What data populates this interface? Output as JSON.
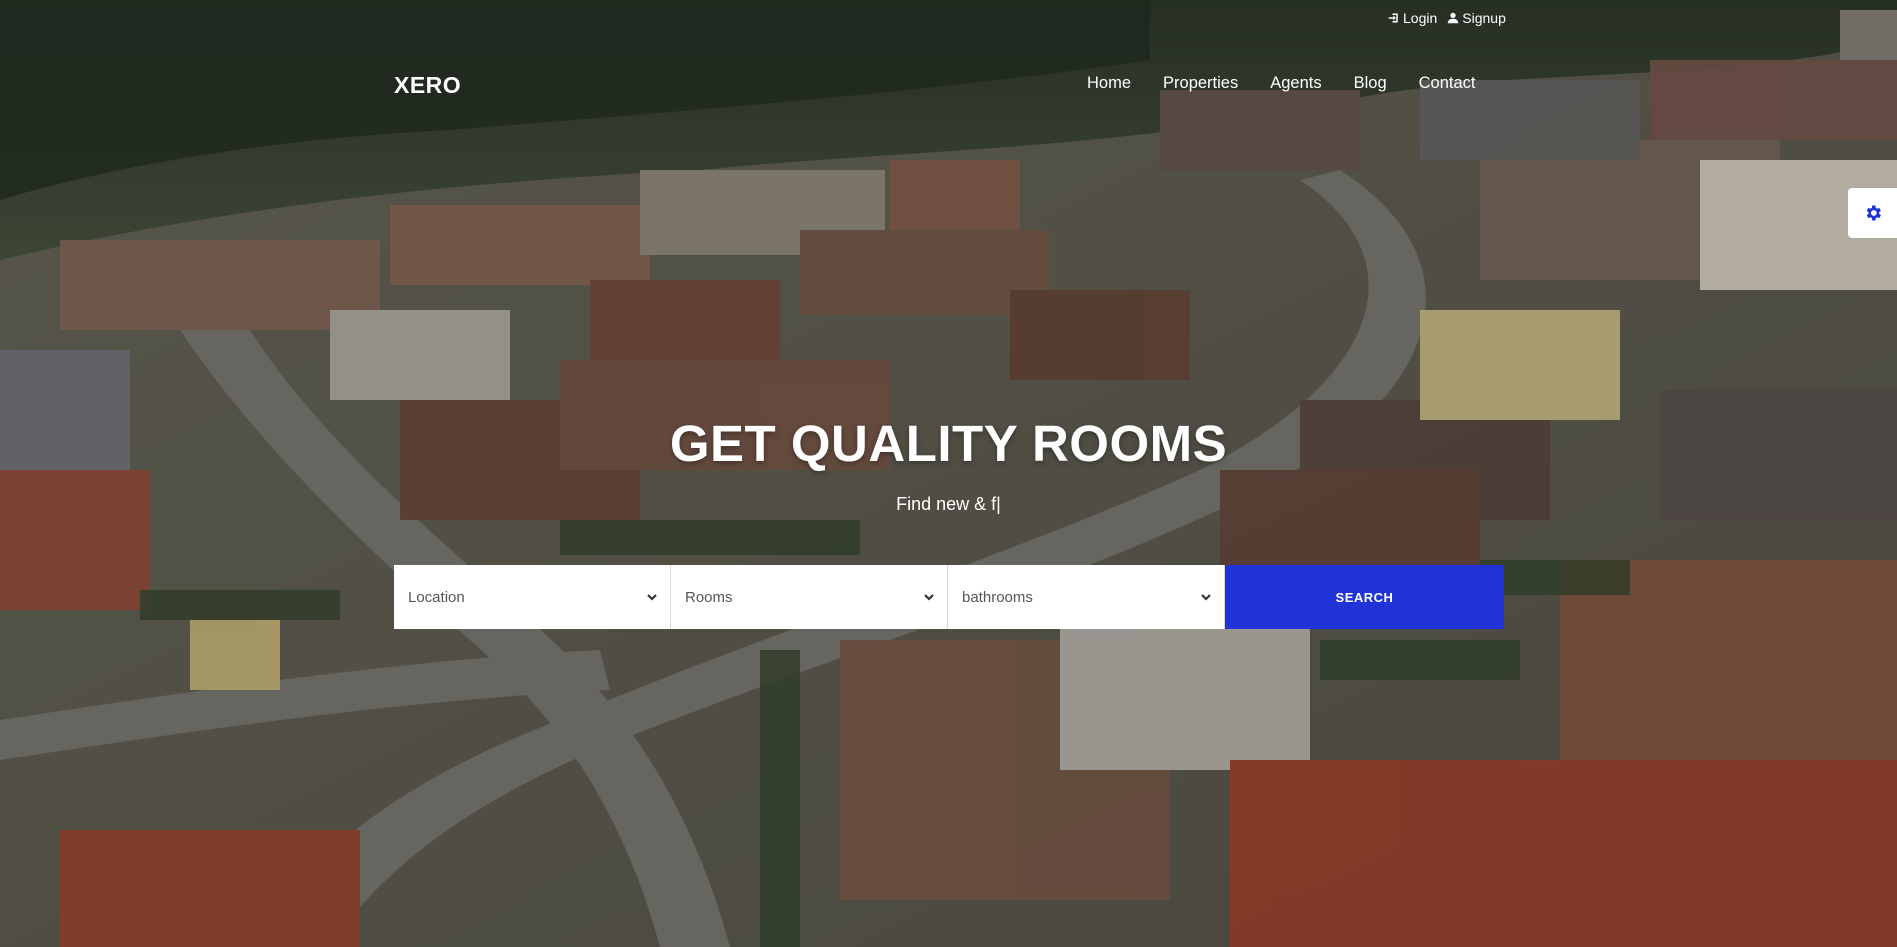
{
  "topbar": {
    "login_label": "Login",
    "signup_label": "Signup"
  },
  "header": {
    "logo": "XERO",
    "nav": [
      "Home",
      "Properties",
      "Agents",
      "Blog",
      "Contact"
    ]
  },
  "hero": {
    "title": "GET QUALITY ROOMS",
    "subtitle": "Find new & f|"
  },
  "search": {
    "location_label": "Location",
    "rooms_label": "Rooms",
    "bathrooms_label": "bathrooms",
    "button_label": "SEARCH"
  },
  "colors": {
    "accent": "#1f33d6",
    "text": "#ffffff"
  },
  "icons": [
    "sign-in-icon",
    "user-icon",
    "gear-icon",
    "chevron-down-icon"
  ]
}
